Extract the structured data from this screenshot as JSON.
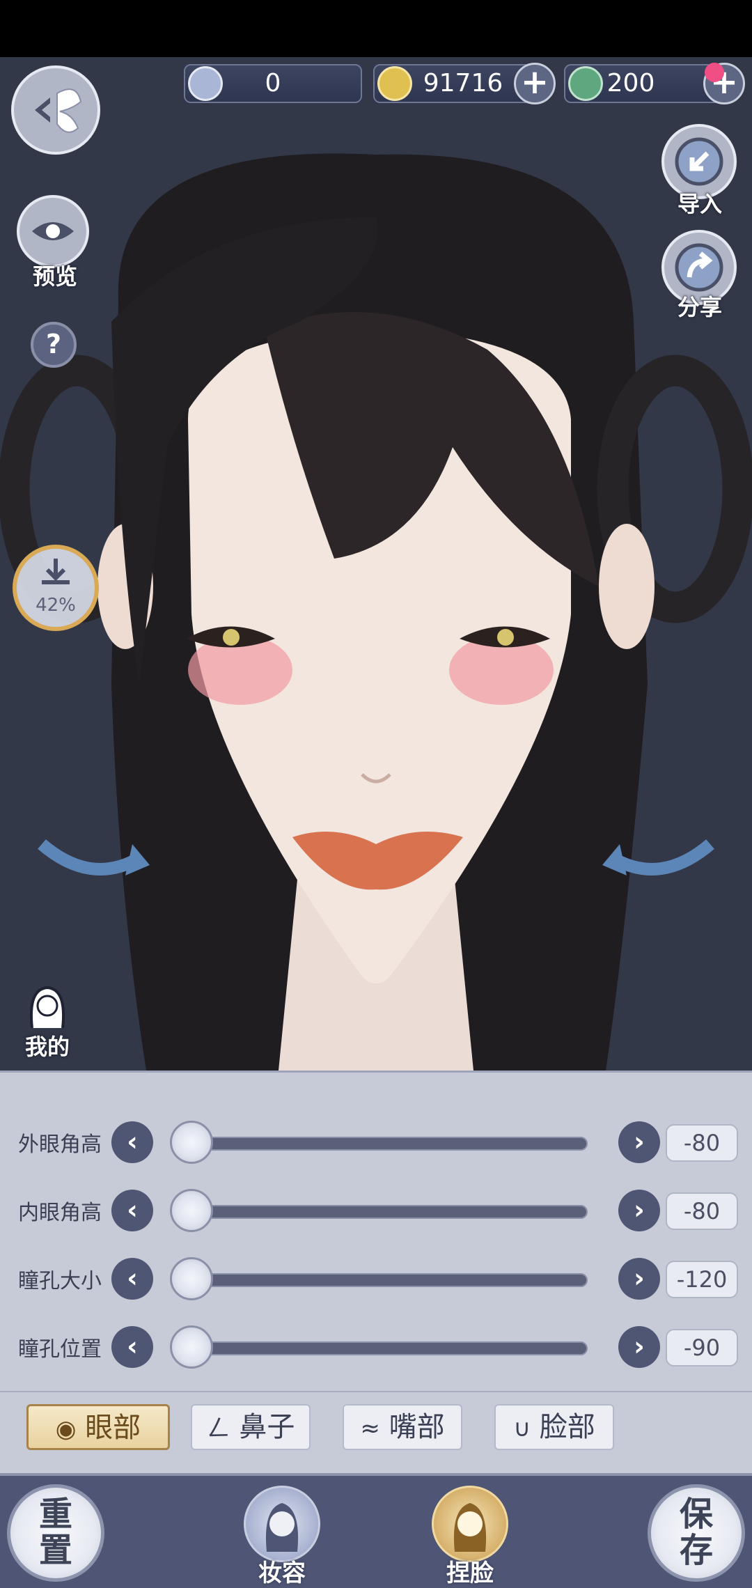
{
  "currency": {
    "item_value": "0",
    "coins_value": "91716",
    "jade_value": "200"
  },
  "side_buttons": {
    "preview_label": "预览",
    "help_label": "?",
    "download_progress": "42%",
    "import_label": "导入",
    "share_label": "分享",
    "mine_label": "我的"
  },
  "sliders": [
    {
      "label": "外眼角高",
      "value": "-80"
    },
    {
      "label": "内眼角高",
      "value": "-80"
    },
    {
      "label": "瞳孔大小",
      "value": "-120"
    },
    {
      "label": "瞳孔位置",
      "value": "-90"
    }
  ],
  "tabs": [
    {
      "label": "眼部",
      "active": true
    },
    {
      "label": "鼻子",
      "active": false
    },
    {
      "label": "嘴部",
      "active": false
    },
    {
      "label": "脸部",
      "active": false
    }
  ],
  "bottom_nav": {
    "reset_label": "重置",
    "makeup_label": "妆容",
    "face_label": "捏脸",
    "save_label": "保存"
  },
  "colors": {
    "viewport_bg": "#323848",
    "panel_bg": "#c7cad7",
    "accent_dark": "#4f5674",
    "active_tab": "#e8d2a0"
  }
}
